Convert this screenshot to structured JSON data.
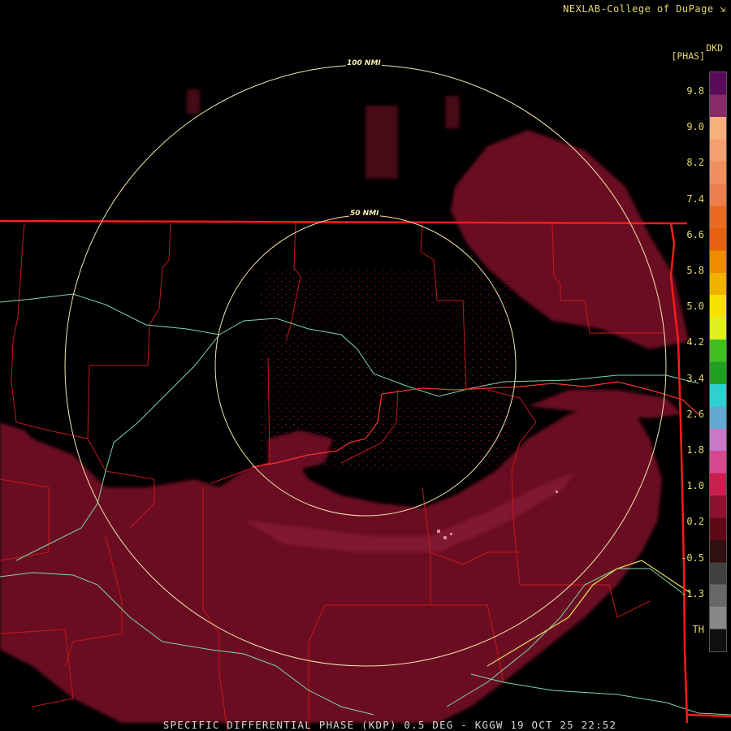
{
  "header": {
    "credit": "NEXLAB-College of DuPage"
  },
  "legend": {
    "product_code": "DKD",
    "unit": "[PHAS]",
    "ticks": [
      "9.8",
      "9.0",
      "8.2",
      "7.4",
      "6.6",
      "5.8",
      "5.0",
      "4.2",
      "3.4",
      "2.6",
      "1.8",
      "1.0",
      "0.2",
      "-0.5",
      "-1.3",
      "TH"
    ],
    "colors": [
      "#5a0a5a",
      "#8a2a6a",
      "#f7b07a",
      "#f4a070",
      "#f09060",
      "#ee8050",
      "#ea6a20",
      "#e66010",
      "#f08a00",
      "#f4b000",
      "#f8e000",
      "#e0f020",
      "#40c020",
      "#20a020",
      "#30d0d0",
      "#60a8d0",
      "#c878c8",
      "#d84890",
      "#c82050",
      "#901030",
      "#600818",
      "#301010",
      "#404040",
      "#686868",
      "#888888",
      "#101010"
    ]
  },
  "map": {
    "range_rings": [
      {
        "label": "50 NMI"
      },
      {
        "label": "100 NMI"
      }
    ],
    "colors": {
      "state_border": "#ff1a1a",
      "county_lines": "#c81818",
      "highway": "#7fd6a8",
      "range_ring": "#f2e6b0",
      "echo": "#6a0f24"
    }
  },
  "footer": {
    "caption": "SPECIFIC DIFFERENTIAL PHASE (KDP) 0.5 DEG - KGGW 19 OCT 25 22:52"
  }
}
